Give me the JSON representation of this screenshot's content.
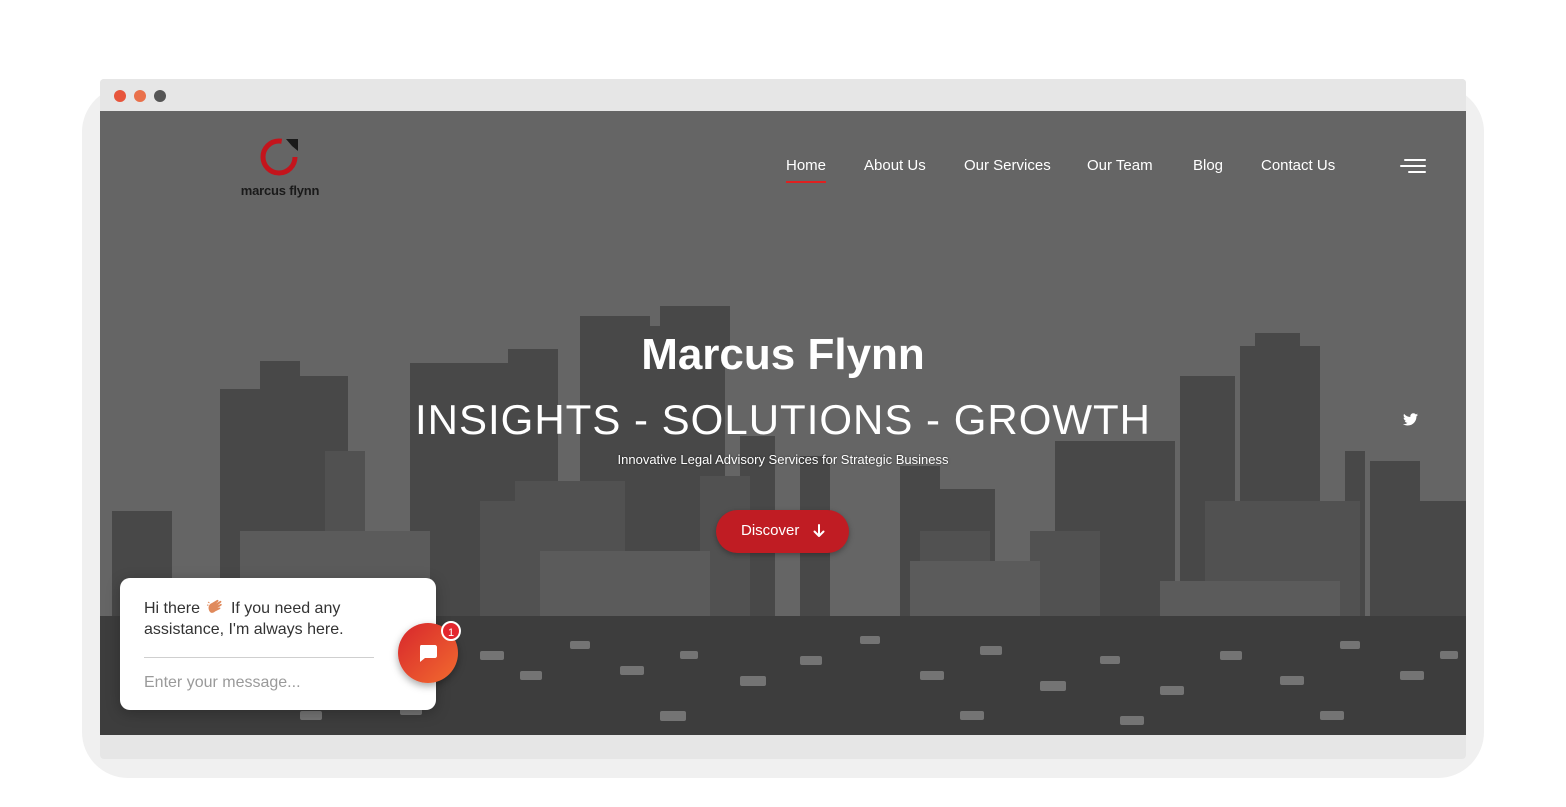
{
  "colors": {
    "accent": "#c01c23",
    "nav_underline": "#e02020",
    "overlay": "#666666",
    "close_dot": "#e7553b",
    "minimize_dot": "#e7553b",
    "maximize_dot": "#555555"
  },
  "brand": {
    "logo_text": "marcus flynn"
  },
  "nav": {
    "items": [
      {
        "label": "Home",
        "active": true
      },
      {
        "label": "About Us"
      },
      {
        "label": "Our Services"
      },
      {
        "label": "Our Team"
      },
      {
        "label": "Blog"
      },
      {
        "label": "Contact Us"
      }
    ],
    "menu_icon": "hamburger-icon"
  },
  "hero": {
    "title": "Marcus Flynn",
    "tagline": "INSIGHTS - SOLUTIONS - GROWTH",
    "subtitle": "Innovative Legal Advisory Services for Strategic Business",
    "cta_label": "Discover",
    "cta_icon": "arrow-down-icon"
  },
  "social": {
    "icon": "twitter-icon"
  },
  "chat": {
    "greeting_start": "Hi there",
    "greeting_end": "If you need any assistance, I'm always here.",
    "input_placeholder": "Enter your message...",
    "badge_count": "1"
  }
}
